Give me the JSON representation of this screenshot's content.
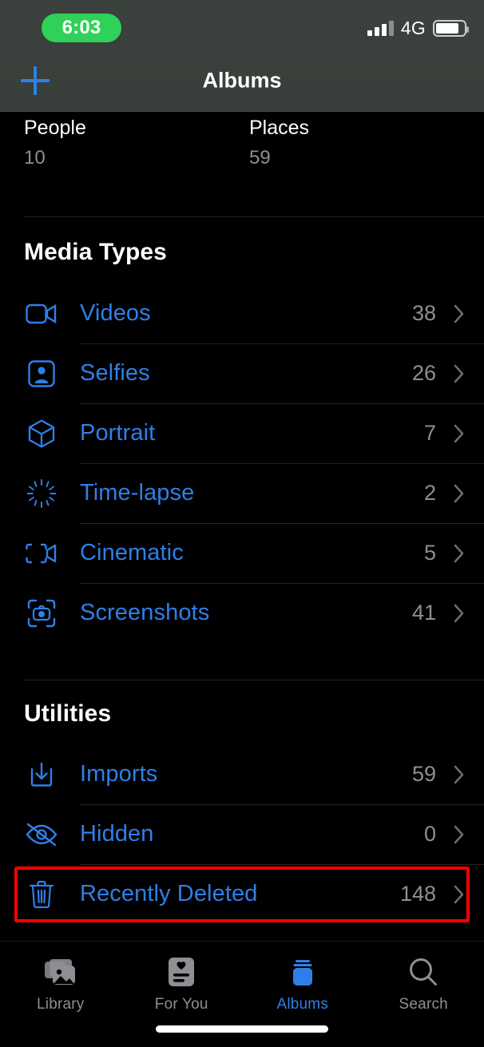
{
  "status_bar": {
    "time": "6:03",
    "network": "4G",
    "signal_icon": "signal-bars-icon",
    "battery_icon": "battery-icon",
    "recording_pill_color": "#30d158"
  },
  "nav": {
    "title": "Albums",
    "add_icon": "plus-icon",
    "accent_color": "#2f7fe8"
  },
  "top_tiles": [
    {
      "title": "People",
      "count": "10",
      "thumb": "people-avatars-thumbnail"
    },
    {
      "title": "Places",
      "count": "59",
      "thumb": "map-thumbnail"
    }
  ],
  "sections": [
    {
      "header": "Media Types",
      "rows": [
        {
          "label": "Videos",
          "count": "38",
          "icon": "video-camera-icon"
        },
        {
          "label": "Selfies",
          "count": "26",
          "icon": "person-square-icon"
        },
        {
          "label": "Portrait",
          "count": "7",
          "icon": "cube-icon"
        },
        {
          "label": "Time-lapse",
          "count": "2",
          "icon": "timelapse-icon"
        },
        {
          "label": "Cinematic",
          "count": "5",
          "icon": "cinematic-video-icon"
        },
        {
          "label": "Screenshots",
          "count": "41",
          "icon": "screenshot-camera-icon"
        }
      ]
    },
    {
      "header": "Utilities",
      "rows": [
        {
          "label": "Imports",
          "count": "59",
          "icon": "import-tray-icon"
        },
        {
          "label": "Hidden",
          "count": "0",
          "icon": "eye-slash-icon"
        },
        {
          "label": "Recently Deleted",
          "count": "148",
          "icon": "trash-icon"
        }
      ]
    }
  ],
  "annotation": {
    "target": "Recently Deleted",
    "color": "#ff0000"
  },
  "tabs": [
    {
      "label": "Library",
      "icon": "photo-stack-icon",
      "active": false
    },
    {
      "label": "For You",
      "icon": "heart-card-icon",
      "active": false
    },
    {
      "label": "Albums",
      "icon": "albums-stack-icon",
      "active": true
    },
    {
      "label": "Search",
      "icon": "magnifier-icon",
      "active": false
    }
  ]
}
